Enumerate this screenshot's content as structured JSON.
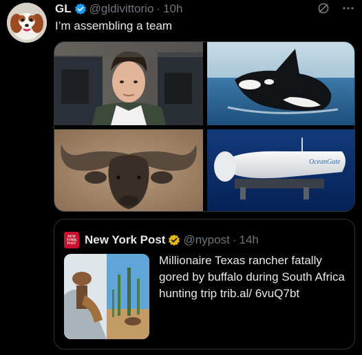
{
  "tweet": {
    "author_name": "GL",
    "handle": "@gldivittorio",
    "separator": "·",
    "time": "10h",
    "text": "I’m assembling a team",
    "more_icon": "ellipsis-icon",
    "grok_icon": "slash-circle-icon"
  },
  "media": {
    "images": [
      "man-in-custody-photo",
      "orca-whale-photo",
      "cape-buffalo-photo",
      "submersible-photo"
    ],
    "submersible_brand": "OceanGate"
  },
  "quote": {
    "author_name": "New York Post",
    "logo_text": "NEW YORK POST",
    "handle": "@nypost",
    "separator": "·",
    "time": "14h",
    "text": "Millionaire Texas rancher fatally gored by buffalo during South Africa hunting trip trib.al/ 6vuQ7bt",
    "thumbnail": "hunting-trip-collage"
  },
  "colors": {
    "background": "#000000",
    "text": "#e7e9ea",
    "muted": "#71767b",
    "verified_blue": "#1d9bf0",
    "verified_gold": "#e2b719",
    "nypost_red": "#c8102e",
    "border": "#2f3336"
  }
}
